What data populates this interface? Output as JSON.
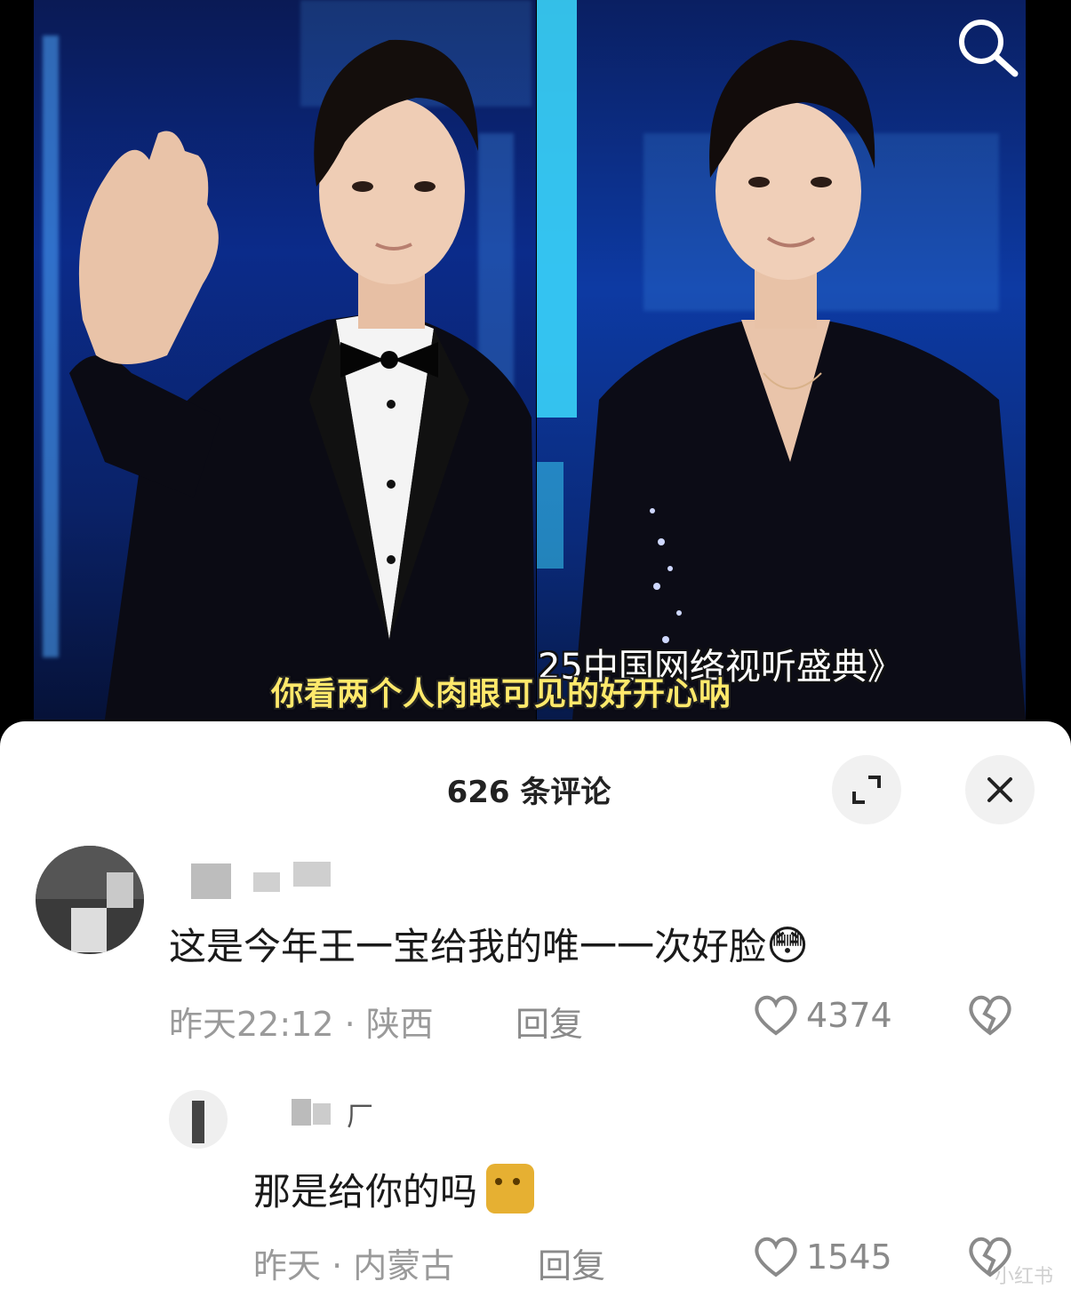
{
  "video": {
    "subtitle": "你看两个人肉眼可见的好开心呐",
    "show_title": "25中国网络视听盛典》"
  },
  "comments_panel": {
    "title": "626 条评论"
  },
  "comments": [
    {
      "text": "这是今年王一宝给我的唯一一次好脸",
      "emoji": "😳",
      "time_location": "昨天22:12 · 陕西",
      "reply_label": "回复",
      "likes": "4374"
    }
  ],
  "reply": {
    "text": "那是给你的吗",
    "time_location": "昨天 · 内蒙古",
    "reply_label": "回复",
    "likes": "1545"
  },
  "watermark": "小红书"
}
